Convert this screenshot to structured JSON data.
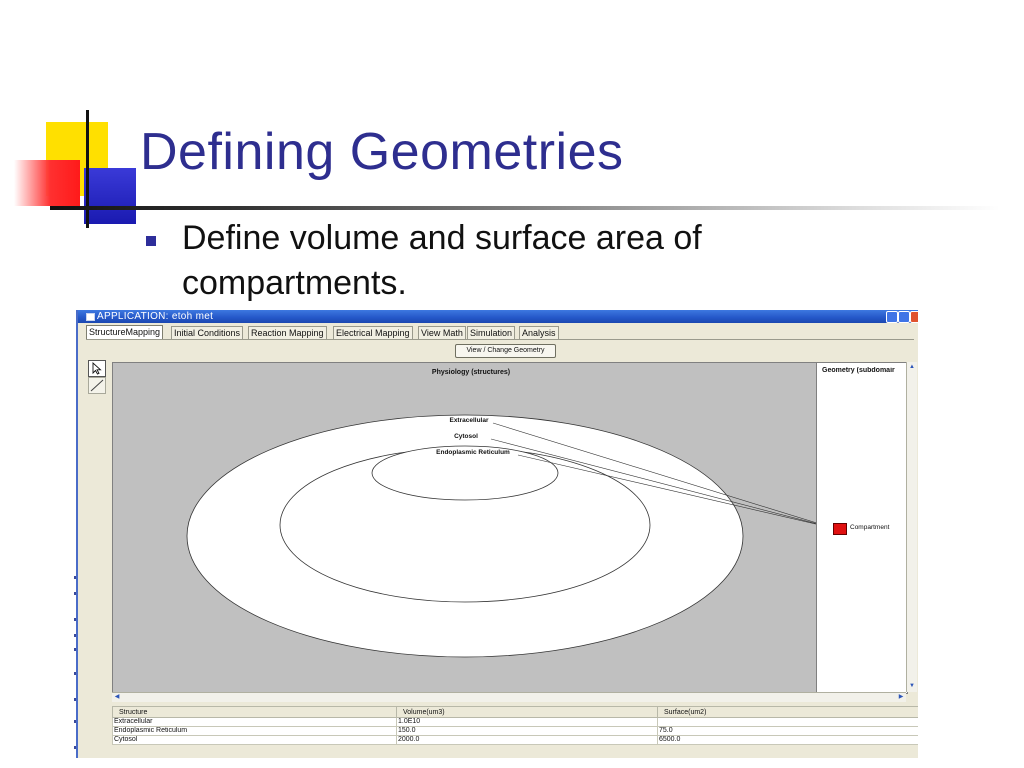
{
  "slide": {
    "title": "Defining Geometries",
    "bullet": "Define volume and surface area of compartments."
  },
  "colors": {
    "title_text": "#2e2e8f",
    "accent_yellow": "#ffe000",
    "accent_red": "#ff1a1a",
    "accent_blue": "#1a1ab0",
    "compartment_fill": "#e01010",
    "canvas_bg": "#c0c0c0"
  },
  "window": {
    "title": "APPLICATION: etoh met",
    "icons": [
      "app-menu-icon",
      "minimize-icon",
      "maximize-icon",
      "close-icon"
    ]
  },
  "tabs": [
    {
      "label": "StructureMapping",
      "active": true
    },
    {
      "label": "Initial Conditions"
    },
    {
      "label": "Reaction Mapping"
    },
    {
      "label": "Electrical Mapping"
    },
    {
      "label": "View Math"
    },
    {
      "label": "Simulation"
    },
    {
      "label": "Analysis"
    }
  ],
  "toolbar": {
    "view_geometry_button": "View / Change Geometry",
    "tools": [
      "select-arrow-icon",
      "line-tool-icon"
    ]
  },
  "physiology": {
    "heading": "Physiology (structures)",
    "structures": [
      "Extracellular",
      "Cytosol",
      "Endoplasmic Reticulum"
    ]
  },
  "geometry": {
    "heading": "Geometry (subdomair",
    "compartment_label": "Compartment"
  },
  "table": {
    "headers": [
      "Structure",
      "Volume(um3)",
      "Surface(um2)"
    ],
    "rows": [
      [
        "Extracellular",
        "1.0E10",
        ""
      ],
      [
        "Endoplasmic Reticulum",
        "150.0",
        "75.0"
      ],
      [
        "Cytosol",
        "2000.0",
        "6500.0"
      ]
    ]
  }
}
